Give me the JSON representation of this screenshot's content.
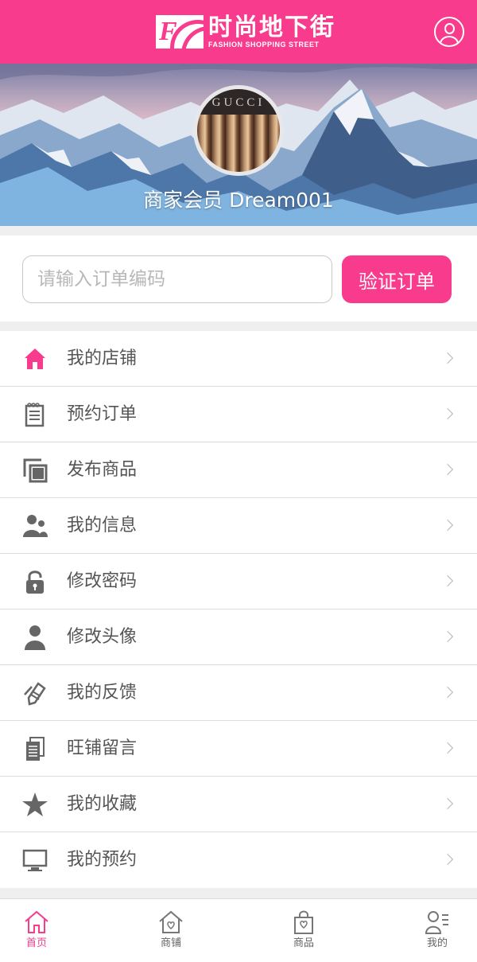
{
  "header": {
    "logo_cn": "时尚地下街",
    "logo_en": "FASHION SHOPPING STREET",
    "logo_mark": "F",
    "user_icon": "user-circle-icon"
  },
  "profile": {
    "avatar_brand": "GUCCI",
    "member_label": "商家会员  Dream001"
  },
  "verify": {
    "placeholder": "请输入订单编码",
    "value": "",
    "button_label": "验证订单"
  },
  "menu": {
    "items": [
      {
        "label": "我的店铺",
        "icon": "home-icon"
      },
      {
        "label": "预约订单",
        "icon": "notepad-icon"
      },
      {
        "label": "发布商品",
        "icon": "copy-icon"
      },
      {
        "label": "我的信息",
        "icon": "users-icon"
      },
      {
        "label": "修改密码",
        "icon": "lock-icon"
      },
      {
        "label": "修改头像",
        "icon": "person-icon"
      },
      {
        "label": "我的反馈",
        "icon": "pen-icon"
      },
      {
        "label": "旺铺留言",
        "icon": "document-icon"
      },
      {
        "label": "我的收藏",
        "icon": "star-icon"
      },
      {
        "label": "我的预约",
        "icon": "monitor-icon"
      }
    ]
  },
  "tabbar": {
    "items": [
      {
        "label": "首页",
        "icon": "home-outline-icon",
        "active": true
      },
      {
        "label": "商铺",
        "icon": "shop-icon",
        "active": false
      },
      {
        "label": "商品",
        "icon": "shopping-bag-icon",
        "active": false
      },
      {
        "label": "我的",
        "icon": "profile-list-icon",
        "active": false
      }
    ]
  },
  "colors": {
    "accent": "#f83b8c",
    "icon_gray": "#666666",
    "text": "#555555"
  }
}
